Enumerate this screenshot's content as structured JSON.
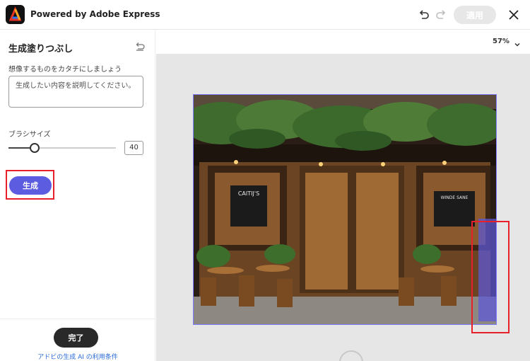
{
  "header": {
    "app_title": "Powered by Adobe Express",
    "apply_label": "適用",
    "undo_icon": "undo-icon",
    "redo_icon": "redo-icon",
    "close_icon": "close-icon",
    "logo_icon": "adobe-express-logo"
  },
  "panel": {
    "title": "生成塗りつぶし",
    "reset_icon": "reset-icon",
    "prompt_label": "想像するものをカタチにしましょう",
    "prompt_placeholder": "生成したい内容を説明してください。",
    "brush_label": "ブラシサイズ",
    "brush_size": "40",
    "brush_fraction": 0.2,
    "generate_label": "生成",
    "done_label": "完了",
    "terms_link": "アドビの生成 AI の利用条件"
  },
  "canvas": {
    "zoom": "57%",
    "zoom_icon": "chevron-down-icon",
    "left_menu_board": "CAITIJ'S",
    "right_menu_board": "WINDE SANE"
  },
  "colors": {
    "accent": "#5c5ce0",
    "highlight": "#e8202a",
    "selection_border": "#7b7bff",
    "done_button": "#292929"
  }
}
